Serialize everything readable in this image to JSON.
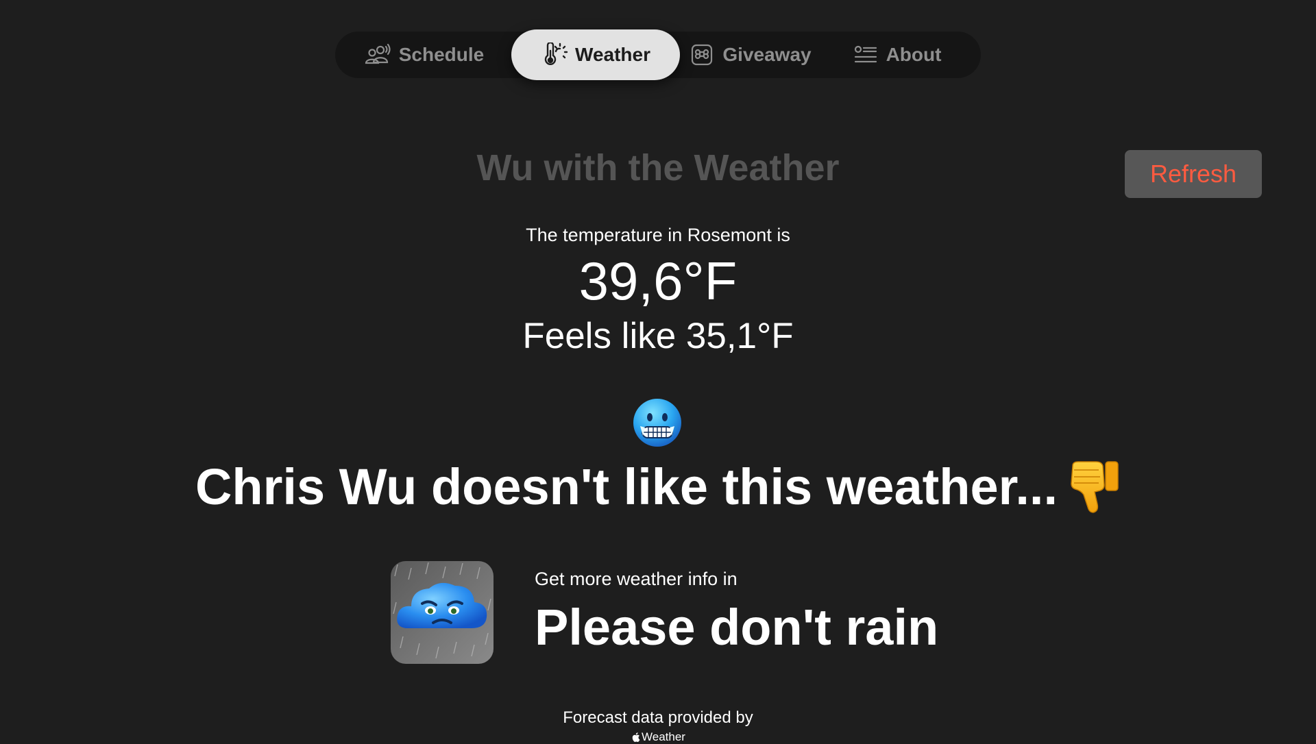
{
  "nav": {
    "tabs": [
      {
        "label": "Schedule",
        "icon": "people-broadcast-icon",
        "active": false
      },
      {
        "label": "Weather",
        "icon": "thermometer-sun-icon",
        "active": true
      },
      {
        "label": "Giveaway",
        "icon": "apple-keyboard-command-icon",
        "active": false
      },
      {
        "label": "About",
        "icon": "list-bullet-rectangle-icon",
        "active": false
      }
    ]
  },
  "header": {
    "title": "Wu with the Weather",
    "refresh_label": "Refresh"
  },
  "weather": {
    "intro": "The temperature in Rosemont is",
    "temperature": "39,6°F",
    "feels_like": "Feels like 35,1°F",
    "mood_emoji": "freezing-face-icon",
    "mood_text": "Chris Wu doesn't like this weather...",
    "mood_reaction": "thumbs-down-icon"
  },
  "promo": {
    "caption": "Get more weather info in",
    "app_name": "Please don't rain",
    "app_icon": "sad-rain-cloud-app-icon"
  },
  "footer": {
    "credit": "Forecast data provided by",
    "provider": "Weather",
    "provider_icon": "apple-logo-icon"
  },
  "colors": {
    "background": "#1e1e1e",
    "tabbar": "#151515",
    "tab_active": "#e2e2e2",
    "title": "#555555",
    "refresh_text": "#ff5b40",
    "refresh_bg": "#575757"
  }
}
